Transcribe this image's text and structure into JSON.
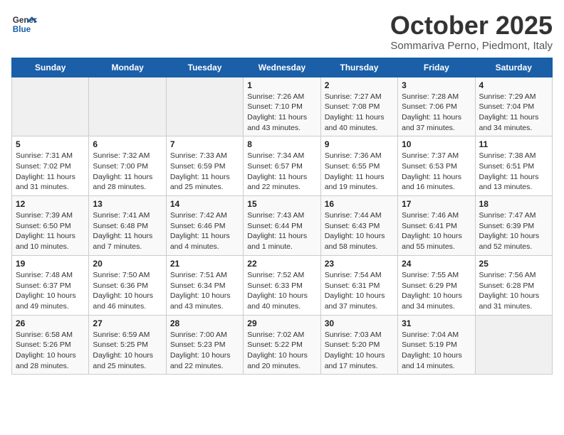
{
  "header": {
    "logo_line1": "General",
    "logo_line2": "Blue",
    "month": "October 2025",
    "location": "Sommariva Perno, Piedmont, Italy"
  },
  "weekdays": [
    "Sunday",
    "Monday",
    "Tuesday",
    "Wednesday",
    "Thursday",
    "Friday",
    "Saturday"
  ],
  "weeks": [
    [
      {
        "day": "",
        "info": ""
      },
      {
        "day": "",
        "info": ""
      },
      {
        "day": "",
        "info": ""
      },
      {
        "day": "1",
        "info": "Sunrise: 7:26 AM\nSunset: 7:10 PM\nDaylight: 11 hours\nand 43 minutes."
      },
      {
        "day": "2",
        "info": "Sunrise: 7:27 AM\nSunset: 7:08 PM\nDaylight: 11 hours\nand 40 minutes."
      },
      {
        "day": "3",
        "info": "Sunrise: 7:28 AM\nSunset: 7:06 PM\nDaylight: 11 hours\nand 37 minutes."
      },
      {
        "day": "4",
        "info": "Sunrise: 7:29 AM\nSunset: 7:04 PM\nDaylight: 11 hours\nand 34 minutes."
      }
    ],
    [
      {
        "day": "5",
        "info": "Sunrise: 7:31 AM\nSunset: 7:02 PM\nDaylight: 11 hours\nand 31 minutes."
      },
      {
        "day": "6",
        "info": "Sunrise: 7:32 AM\nSunset: 7:00 PM\nDaylight: 11 hours\nand 28 minutes."
      },
      {
        "day": "7",
        "info": "Sunrise: 7:33 AM\nSunset: 6:59 PM\nDaylight: 11 hours\nand 25 minutes."
      },
      {
        "day": "8",
        "info": "Sunrise: 7:34 AM\nSunset: 6:57 PM\nDaylight: 11 hours\nand 22 minutes."
      },
      {
        "day": "9",
        "info": "Sunrise: 7:36 AM\nSunset: 6:55 PM\nDaylight: 11 hours\nand 19 minutes."
      },
      {
        "day": "10",
        "info": "Sunrise: 7:37 AM\nSunset: 6:53 PM\nDaylight: 11 hours\nand 16 minutes."
      },
      {
        "day": "11",
        "info": "Sunrise: 7:38 AM\nSunset: 6:51 PM\nDaylight: 11 hours\nand 13 minutes."
      }
    ],
    [
      {
        "day": "12",
        "info": "Sunrise: 7:39 AM\nSunset: 6:50 PM\nDaylight: 11 hours\nand 10 minutes."
      },
      {
        "day": "13",
        "info": "Sunrise: 7:41 AM\nSunset: 6:48 PM\nDaylight: 11 hours\nand 7 minutes."
      },
      {
        "day": "14",
        "info": "Sunrise: 7:42 AM\nSunset: 6:46 PM\nDaylight: 11 hours\nand 4 minutes."
      },
      {
        "day": "15",
        "info": "Sunrise: 7:43 AM\nSunset: 6:44 PM\nDaylight: 11 hours\nand 1 minute."
      },
      {
        "day": "16",
        "info": "Sunrise: 7:44 AM\nSunset: 6:43 PM\nDaylight: 10 hours\nand 58 minutes."
      },
      {
        "day": "17",
        "info": "Sunrise: 7:46 AM\nSunset: 6:41 PM\nDaylight: 10 hours\nand 55 minutes."
      },
      {
        "day": "18",
        "info": "Sunrise: 7:47 AM\nSunset: 6:39 PM\nDaylight: 10 hours\nand 52 minutes."
      }
    ],
    [
      {
        "day": "19",
        "info": "Sunrise: 7:48 AM\nSunset: 6:37 PM\nDaylight: 10 hours\nand 49 minutes."
      },
      {
        "day": "20",
        "info": "Sunrise: 7:50 AM\nSunset: 6:36 PM\nDaylight: 10 hours\nand 46 minutes."
      },
      {
        "day": "21",
        "info": "Sunrise: 7:51 AM\nSunset: 6:34 PM\nDaylight: 10 hours\nand 43 minutes."
      },
      {
        "day": "22",
        "info": "Sunrise: 7:52 AM\nSunset: 6:33 PM\nDaylight: 10 hours\nand 40 minutes."
      },
      {
        "day": "23",
        "info": "Sunrise: 7:54 AM\nSunset: 6:31 PM\nDaylight: 10 hours\nand 37 minutes."
      },
      {
        "day": "24",
        "info": "Sunrise: 7:55 AM\nSunset: 6:29 PM\nDaylight: 10 hours\nand 34 minutes."
      },
      {
        "day": "25",
        "info": "Sunrise: 7:56 AM\nSunset: 6:28 PM\nDaylight: 10 hours\nand 31 minutes."
      }
    ],
    [
      {
        "day": "26",
        "info": "Sunrise: 6:58 AM\nSunset: 5:26 PM\nDaylight: 10 hours\nand 28 minutes."
      },
      {
        "day": "27",
        "info": "Sunrise: 6:59 AM\nSunset: 5:25 PM\nDaylight: 10 hours\nand 25 minutes."
      },
      {
        "day": "28",
        "info": "Sunrise: 7:00 AM\nSunset: 5:23 PM\nDaylight: 10 hours\nand 22 minutes."
      },
      {
        "day": "29",
        "info": "Sunrise: 7:02 AM\nSunset: 5:22 PM\nDaylight: 10 hours\nand 20 minutes."
      },
      {
        "day": "30",
        "info": "Sunrise: 7:03 AM\nSunset: 5:20 PM\nDaylight: 10 hours\nand 17 minutes."
      },
      {
        "day": "31",
        "info": "Sunrise: 7:04 AM\nSunset: 5:19 PM\nDaylight: 10 hours\nand 14 minutes."
      },
      {
        "day": "",
        "info": ""
      }
    ]
  ]
}
